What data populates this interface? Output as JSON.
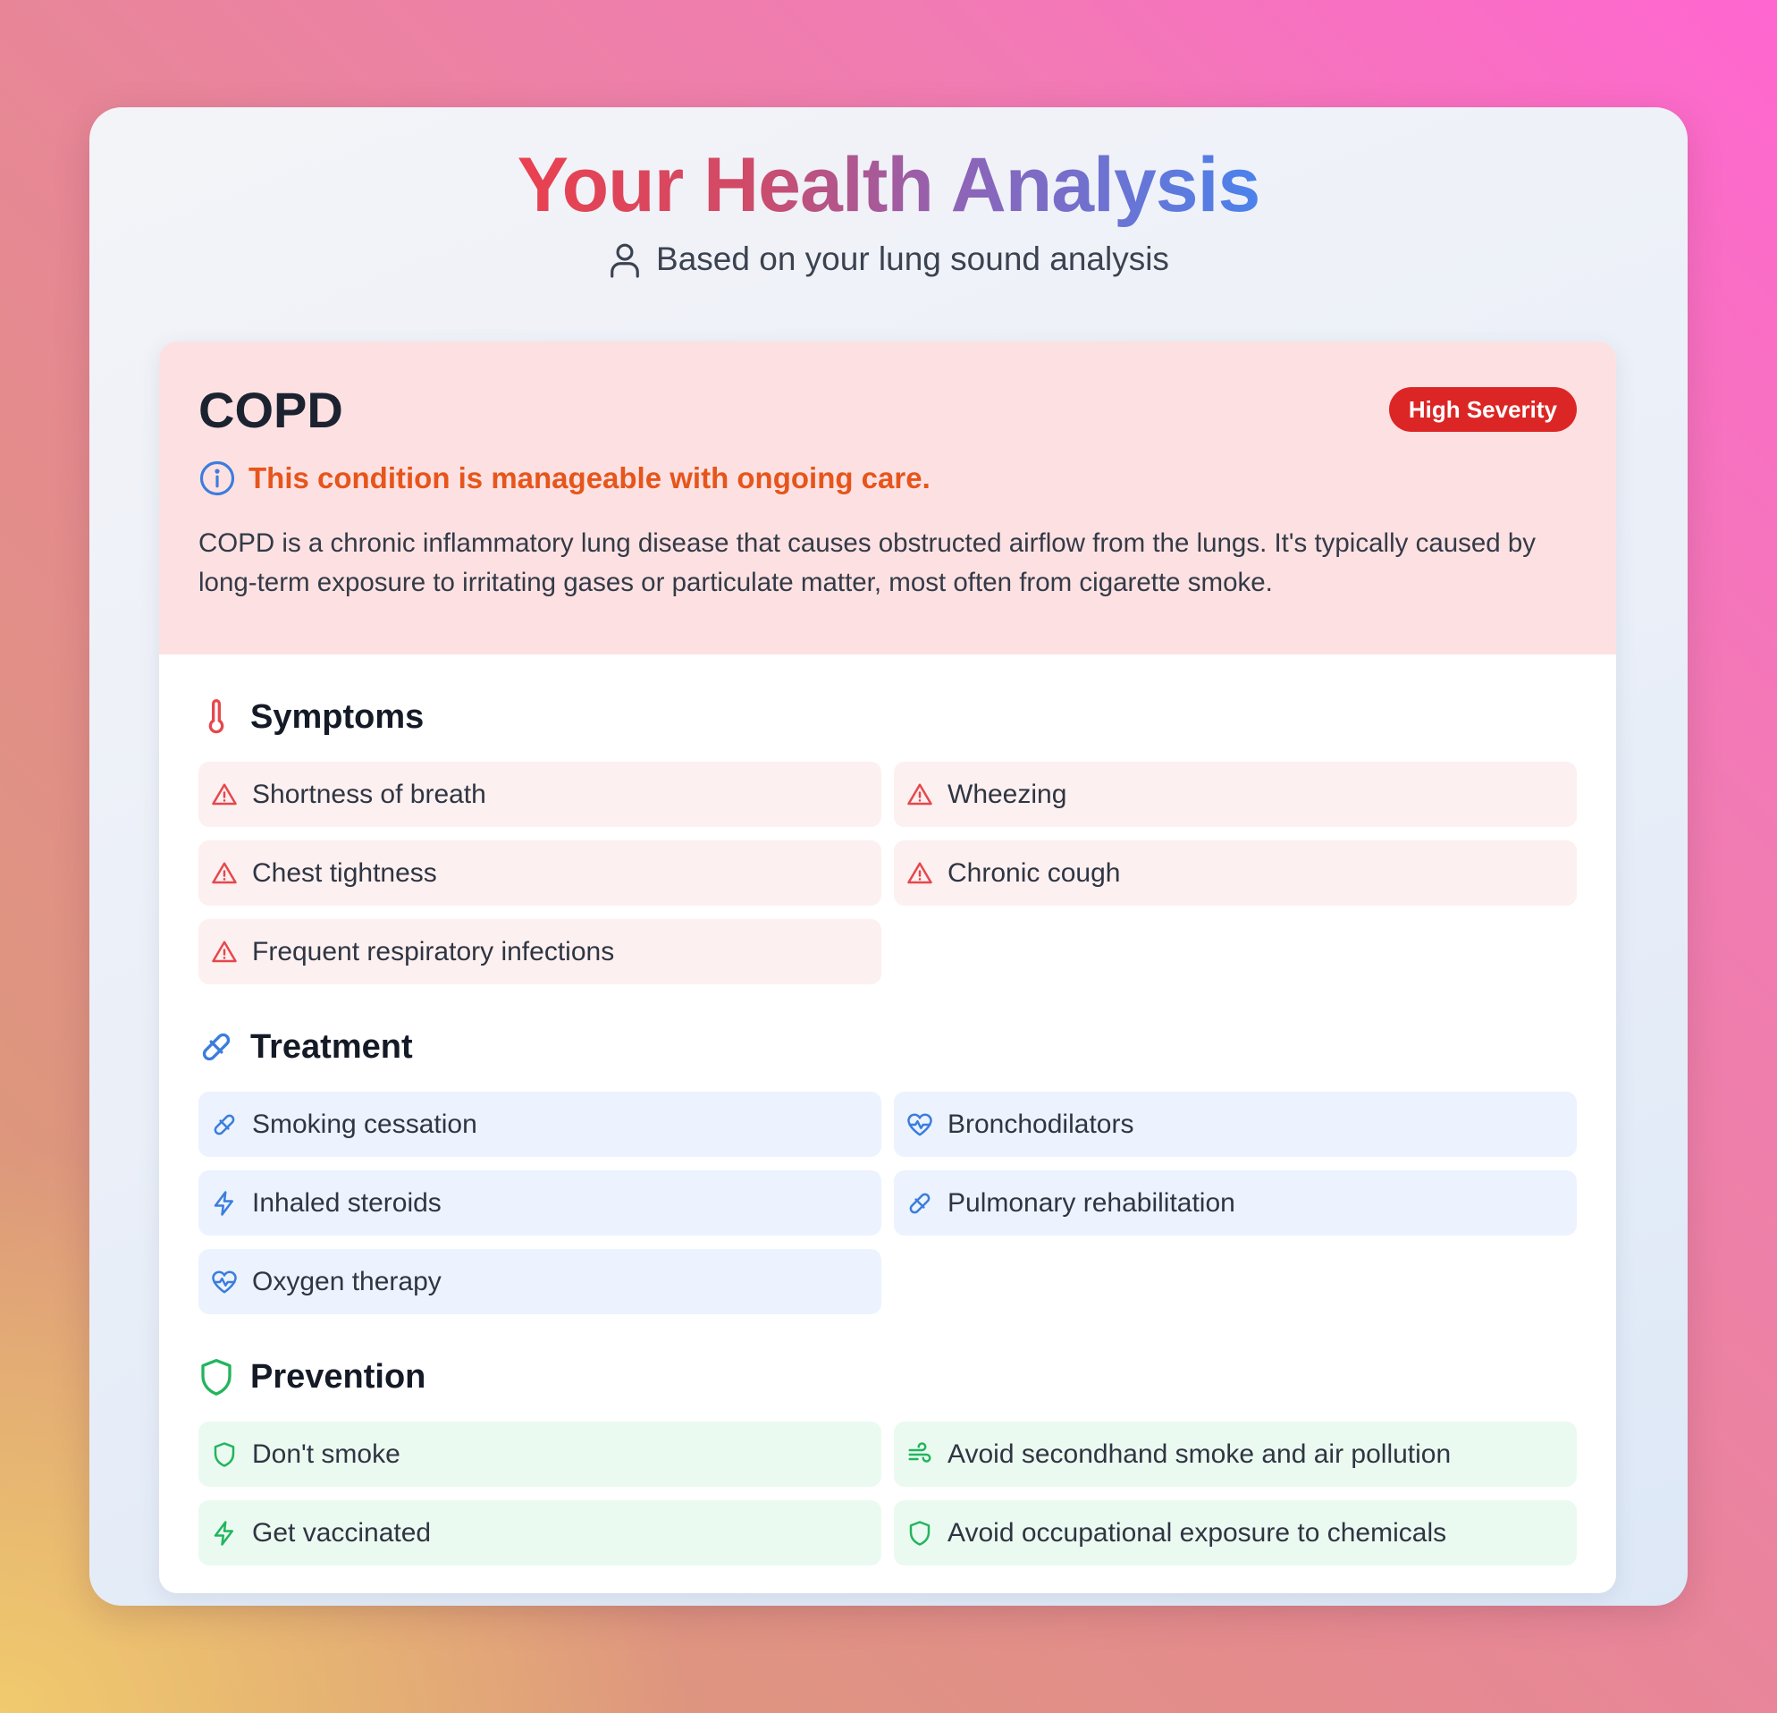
{
  "header": {
    "title": "Your Health Analysis",
    "subtitle": "Based on your lung sound analysis"
  },
  "condition": {
    "name": "COPD",
    "severity": "High Severity",
    "manageable": "This condition is manageable with ongoing care.",
    "description": "COPD is a chronic inflammatory lung disease that causes obstructed airflow from the lungs. It's typically caused by long-term exposure to irritating gases or particulate matter, most often from cigarette smoke."
  },
  "symptoms": {
    "title": "Symptoms",
    "icon": "thermometer-icon",
    "items": [
      {
        "label": "Shortness of breath",
        "icon": "warning-icon"
      },
      {
        "label": "Wheezing",
        "icon": "warning-icon"
      },
      {
        "label": "Chest tightness",
        "icon": "warning-icon"
      },
      {
        "label": "Chronic cough",
        "icon": "warning-icon"
      },
      {
        "label": "Frequent respiratory infections",
        "icon": "warning-icon"
      }
    ]
  },
  "treatment": {
    "title": "Treatment",
    "icon": "pill-icon",
    "items": [
      {
        "label": "Smoking cessation",
        "icon": "pill-icon"
      },
      {
        "label": "Bronchodilators",
        "icon": "heart-pulse-icon"
      },
      {
        "label": "Inhaled steroids",
        "icon": "lightning-icon"
      },
      {
        "label": "Pulmonary rehabilitation",
        "icon": "pill-icon"
      },
      {
        "label": "Oxygen therapy",
        "icon": "heart-pulse-icon"
      }
    ]
  },
  "prevention": {
    "title": "Prevention",
    "icon": "shield-icon",
    "items": [
      {
        "label": "Don't smoke",
        "icon": "shield-icon"
      },
      {
        "label": "Avoid secondhand smoke and air pollution",
        "icon": "wind-icon"
      },
      {
        "label": "Get vaccinated",
        "icon": "lightning-icon"
      },
      {
        "label": "Avoid occupational exposure to chemicals",
        "icon": "shield-icon"
      }
    ]
  },
  "colors": {
    "severity_badge": "#dc2626",
    "manageable_text": "#e6551b",
    "symptoms_accent": "#e5484d",
    "treatment_accent": "#3b7ddd",
    "prevention_accent": "#22b55e"
  }
}
